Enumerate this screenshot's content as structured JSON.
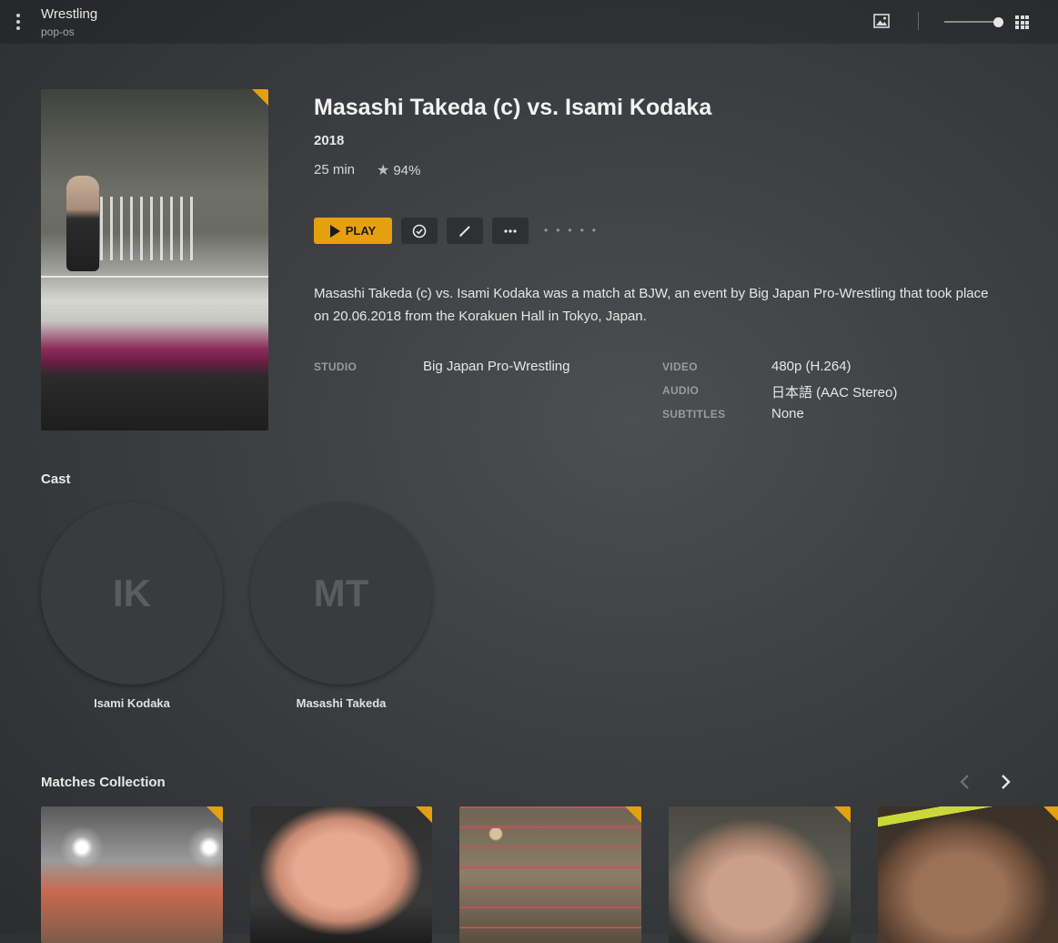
{
  "header": {
    "library_title": "Wrestling",
    "server_name": "pop-os",
    "icons": [
      "more-vertical-icon",
      "photo-icon",
      "grid-icon"
    ]
  },
  "details": {
    "title": "Masashi Takeda (c) vs. Isami Kodaka",
    "year": "2018",
    "duration": "25 min",
    "rating": "94%",
    "play_label": "PLAY",
    "summary": "Masashi Takeda (c) vs. Isami Kodaka was a match at BJW, an event by Big Japan Pro-Wrestling that took place on 20.06.2018 from the Korakuen Hall in Tokyo, Japan.",
    "studio_label": "STUDIO",
    "studio": "Big Japan Pro-Wrestling",
    "video_label": "VIDEO",
    "video": "480p (H.264)",
    "audio_label": "AUDIO",
    "audio": "日本語 (AAC Stereo)",
    "subtitles_label": "SUBTITLES",
    "subtitles": "None"
  },
  "cast": {
    "title": "Cast",
    "members": [
      {
        "initials": "IK",
        "name": "Isami Kodaka"
      },
      {
        "initials": "MT",
        "name": "Masashi Takeda"
      }
    ]
  },
  "collection": {
    "title": "Matches Collection",
    "item_count_visible": 5
  },
  "colors": {
    "accent": "#e5a00d",
    "background": "#3c3f41"
  }
}
